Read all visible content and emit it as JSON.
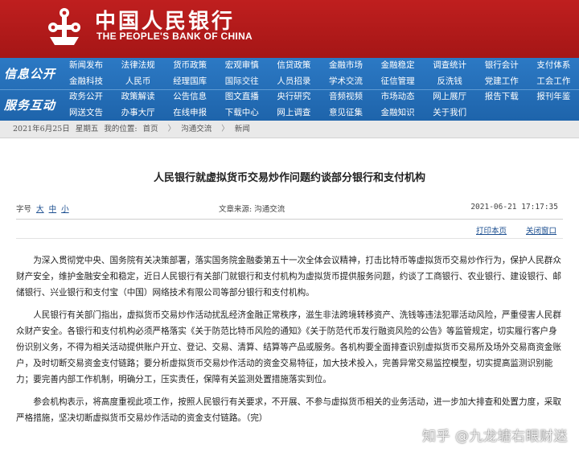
{
  "header": {
    "bank_name_cn": "中国人民银行",
    "bank_name_en": "THE PEOPLE'S BANK OF CHINA",
    "logo_icon": "pboc-emblem-icon",
    "brand_color": "#bf1f1f"
  },
  "nav": {
    "section_1": "信息公开",
    "section_2": "服务互动",
    "row_1": [
      "新闻发布",
      "法律法规",
      "货币政策",
      "宏观审慎",
      "信贷政策",
      "金融市场",
      "金融稳定",
      "调查统计",
      "银行会计",
      "支付体系"
    ],
    "row_2": [
      "金融科技",
      "人民币",
      "经理国库",
      "国际交往",
      "人员招录",
      "学术交流",
      "征信管理",
      "反洗钱",
      "党建工作",
      "工会工作"
    ],
    "row_3": [
      "政务公开",
      "政策解读",
      "公告信息",
      "图文直播",
      "央行研究",
      "音频视频",
      "市场动态",
      "网上展厅",
      "报告下载",
      "报刊年鉴"
    ],
    "row_4": [
      "网送文告",
      "办事大厅",
      "在线申报",
      "下载中心",
      "网上调查",
      "意见征集",
      "金融知识",
      "关于我们"
    ],
    "nav_color": "#2c79c4"
  },
  "breadcrumb": {
    "date": "2021年6月25日",
    "weekday": "星期五",
    "location_label": "我的位置:",
    "items": [
      "首页",
      "沟通交流",
      "新闻"
    ]
  },
  "article": {
    "title": "人民银行就虚拟货币交易炒作问题约谈部分银行和支付机构",
    "size_label": "字号",
    "size_large": "大",
    "size_medium": "中",
    "size_small": "小",
    "source": "文章来源:  沟通交流",
    "datetime": "2021-06-21 17:17:35",
    "print_label": "打印本页",
    "close_label": "关闭窗口",
    "paragraphs": [
      "为深入贯彻党中央、国务院有关决策部署，落实国务院金融委第五十一次全体会议精神，打击比特币等虚拟货币交易炒作行为，保护人民群众财产安全，维护金融安全和稳定，近日人民银行有关部门就银行和支付机构为虚拟货币提供服务问题，约谈了工商银行、农业银行、建设银行、邮储银行、兴业银行和支付宝（中国）网络技术有限公司等部分银行和支付机构。",
      "人民银行有关部门指出，虚拟货币交易炒作活动扰乱经济金融正常秩序，滋生非法跨境转移资产、洗钱等违法犯罪活动风险，严重侵害人民群众财产安全。各银行和支付机构必须严格落实《关于防范比特币风险的通知》《关于防范代币发行融资风险的公告》等监管规定，切实履行客户身份识别义务，不得为相关活动提供账户开立、登记、交易、清算、结算等产品或服务。各机构要全面排查识别虚拟货币交易所及场外交易商资金账户，及时切断交易资金支付链路；要分析虚拟货币交易炒作活动的资金交易特征，加大技术投入，完善异常交易监控模型，切实提高监测识别能力；要完善内部工作机制，明确分工，压实责任，保障有关监测处置措施落实到位。",
      "参会机构表示，将高度重视此项工作，按照人民银行有关要求，不开展、不参与虚拟货币相关的业务活动，进一步加大排查和处置力度，采取严格措施，坚决切断虚拟货币交易炒作活动的资金支付链路。（完）"
    ]
  },
  "watermark": "知乎 @九龙塘右眼财迷"
}
